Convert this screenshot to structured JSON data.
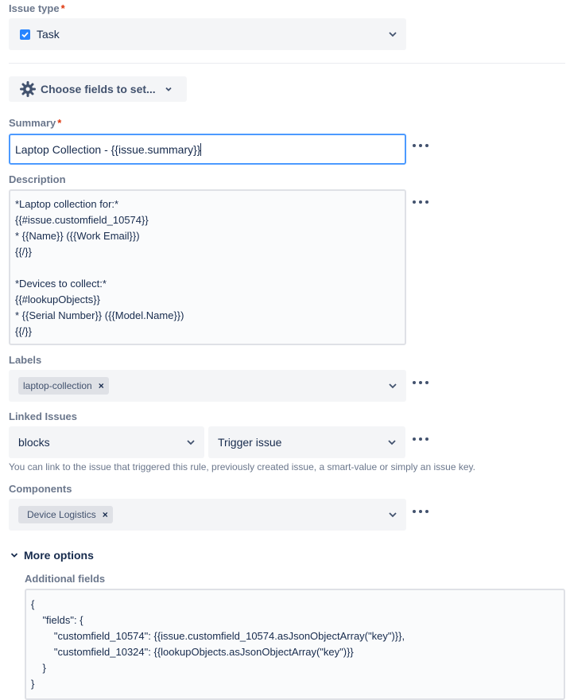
{
  "issue_type": {
    "label": "Issue type",
    "required_mark": "*",
    "value": "Task"
  },
  "choose_fields": {
    "label": "Choose fields to set..."
  },
  "summary": {
    "label": "Summary",
    "required_mark": "*",
    "value": "Laptop Collection - {{issue.summary}}"
  },
  "description": {
    "label": "Description",
    "lines": [
      "*Laptop collection for:*",
      "{{#issue.customfield_10574}}",
      "* {{Name}} ({{Work Email}})",
      "{{/}}",
      "",
      "*Devices to collect:*",
      "{{#lookupObjects}}",
      "* {{Serial Number}} ({{Model.Name}})",
      "{{/}}"
    ]
  },
  "labels": {
    "label": "Labels",
    "tags": [
      "laptop-collection"
    ]
  },
  "linked_issues": {
    "label": "Linked Issues",
    "link_type": "blocks",
    "target": "Trigger issue",
    "help": "You can link to the issue that triggered this rule, previously created issue, a smart-value or simply an issue key."
  },
  "components": {
    "label": "Components",
    "tags": [
      "Device Logistics"
    ]
  },
  "more_options": {
    "label": "More options"
  },
  "additional_fields": {
    "label": "Additional fields",
    "lines": [
      "{",
      "    \"fields\": {",
      "        \"customfield_10574\": {{issue.customfield_10574.asJsonObjectArray(\"key\")}},",
      "        \"customfield_10324\": {{lookupObjects.asJsonObjectArray(\"key\")}}",
      "    }",
      "}"
    ]
  },
  "colors": {
    "focus_border": "#4c9aff",
    "checkbox": "#0052cc",
    "required": "#de350b",
    "field_bg": "#f4f5f7"
  }
}
